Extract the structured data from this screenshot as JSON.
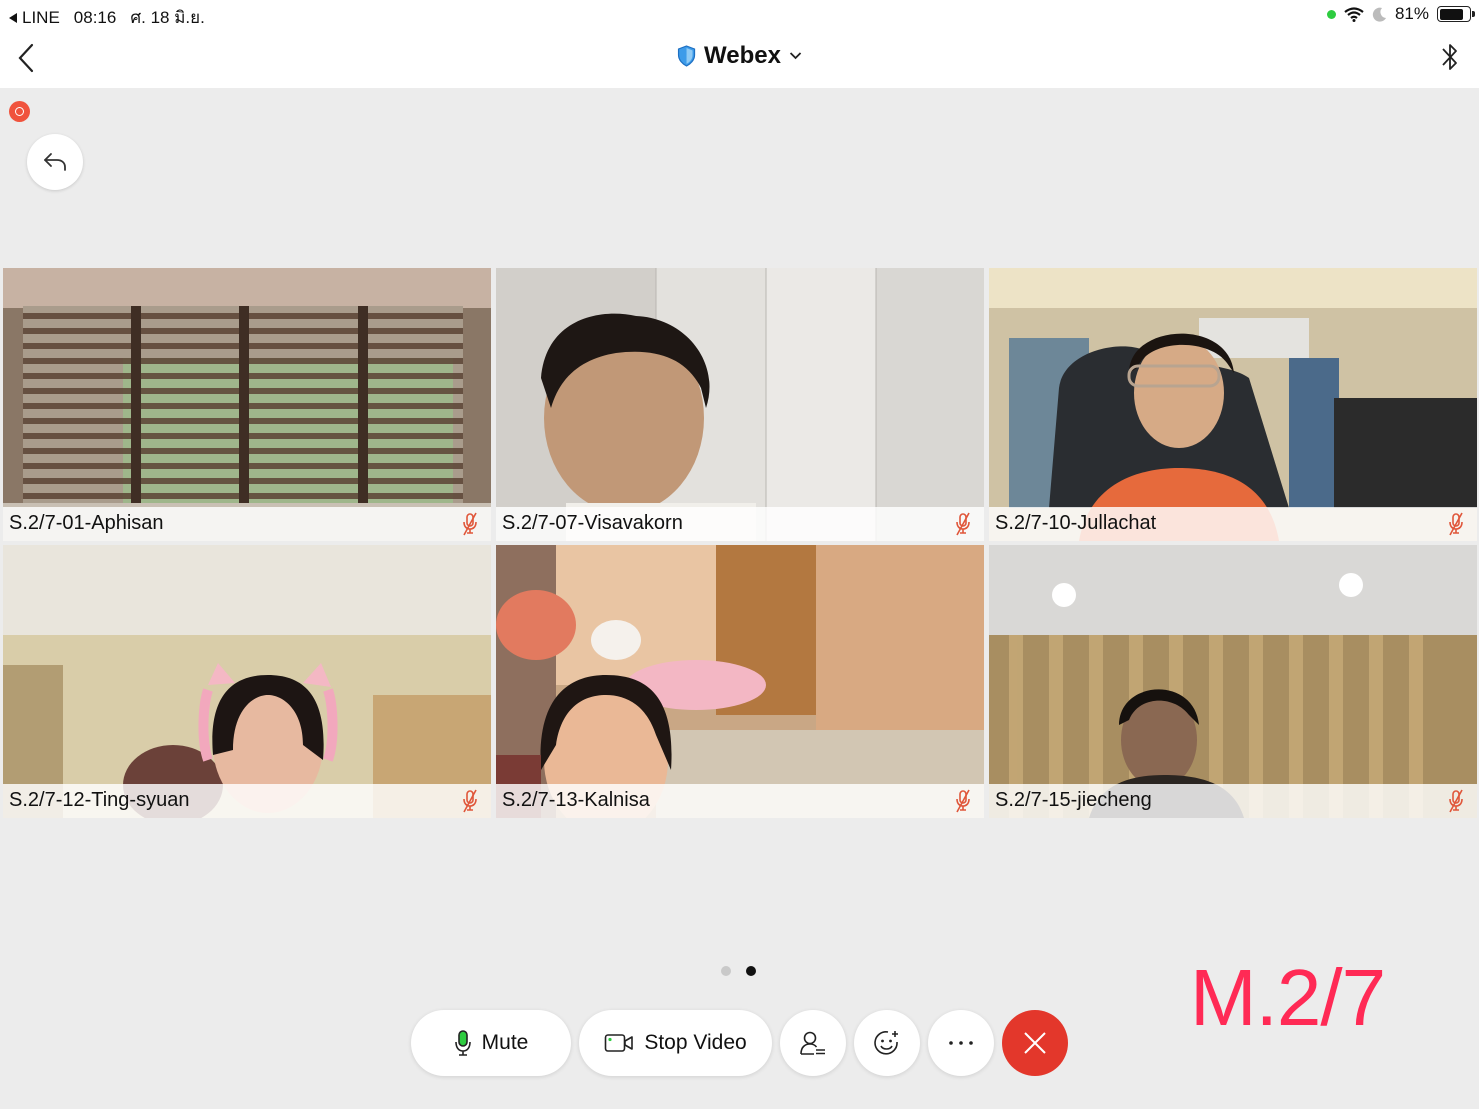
{
  "status_bar": {
    "back_app": "LINE",
    "time": "08:16",
    "date": "ศ. 18 มิ.ย.",
    "battery": "81%",
    "battery_level": 0.81
  },
  "nav": {
    "title": "Webex"
  },
  "participants": [
    {
      "name": "S.2/7-01-Aphisan",
      "muted": true
    },
    {
      "name": "S.2/7-07-Visavakorn",
      "muted": true
    },
    {
      "name": "S.2/7-10-Jullachat",
      "muted": true
    },
    {
      "name": "S.2/7-12-Ting-syuan",
      "muted": true
    },
    {
      "name": "S.2/7-13-Kalnisa",
      "muted": true
    },
    {
      "name": "S.2/7-15-jiecheng",
      "muted": true
    }
  ],
  "pager": {
    "pages": 2,
    "current": 2
  },
  "caption": "M.2/7",
  "controls": {
    "mute_label": "Mute",
    "stop_video_label": "Stop Video"
  },
  "colors": {
    "accent_red": "#e3372b",
    "caption_red": "#ff2a55",
    "muted_icon": "#e0563a",
    "webex_shield": "#3d9be9"
  }
}
